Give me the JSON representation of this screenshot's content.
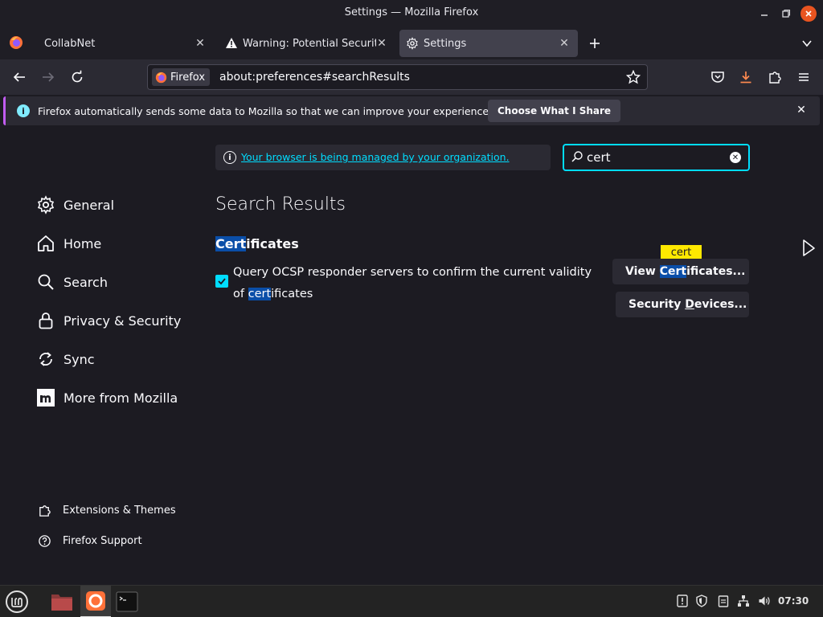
{
  "window": {
    "title": "Settings — Mozilla Firefox"
  },
  "tabs": [
    {
      "label": "CollabNet"
    },
    {
      "label": "Warning: Potential Security Risk Ahead"
    },
    {
      "label": "Settings"
    }
  ],
  "nav": {
    "identity_label": "Firefox",
    "url": "about:preferences#searchResults"
  },
  "notification": {
    "message": "Firefox automatically sends some data to Mozilla so that we can improve your experience.",
    "action_label": "Choose What I Share"
  },
  "managed_notice": "Your browser is being managed by your organization.",
  "search": {
    "value": "cert"
  },
  "categories": [
    {
      "label": "General"
    },
    {
      "label": "Home"
    },
    {
      "label": "Search"
    },
    {
      "label": "Privacy & Security"
    },
    {
      "label": "Sync"
    },
    {
      "label": "More from Mozilla"
    }
  ],
  "footer": {
    "extensions_label": "Extensions & Themes",
    "support_label": "Firefox Support"
  },
  "results": {
    "heading": "Search Results",
    "section": {
      "match": "Cert",
      "rest": "ificates"
    },
    "ocsp": {
      "text": "Query OCSP responder servers to confirm the current validity of",
      "match": "cert",
      "rest": "ificates",
      "checked": true
    },
    "tooltip": "cert",
    "view_cert_button": {
      "prefix": "View ",
      "match": "Cert",
      "rest": "ificates..."
    },
    "security_devices_button": {
      "prefix": "Security ",
      "underline": "D",
      "rest": "evices..."
    }
  },
  "taskbar": {
    "clock": "07:30"
  },
  "colors": {
    "accent": "#00ddff",
    "highlight": "#0a4ea8",
    "tooltip": "#ffe900",
    "close": "#e95420"
  }
}
